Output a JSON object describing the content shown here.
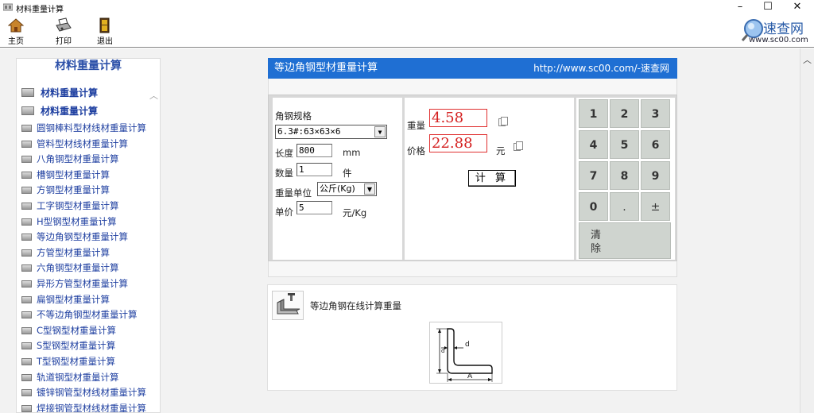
{
  "window": {
    "title": "材料重量计算",
    "controls": {
      "minimize": "–",
      "maximize": "☐",
      "close": "✕"
    }
  },
  "toolbar": {
    "home_label": "主页",
    "print_label": "打印",
    "exit_label": "退出"
  },
  "logo": {
    "brand": "速查网",
    "url": "www.sc00.com"
  },
  "sidebar": {
    "heading": "材料重量计算",
    "items": [
      {
        "label": "材料重量计算",
        "big": true
      },
      {
        "label": "材料重量计算",
        "big": true
      },
      {
        "label": "圆钢棒料型材线材重量计算"
      },
      {
        "label": "管料型材线材重量计算"
      },
      {
        "label": "八角钢型材重量计算"
      },
      {
        "label": "槽钢型材重量计算"
      },
      {
        "label": "方钢型材重量计算"
      },
      {
        "label": "工字钢型材重量计算"
      },
      {
        "label": "H型钢型材重量计算"
      },
      {
        "label": "等边角钢型材重量计算"
      },
      {
        "label": "方管型材重量计算"
      },
      {
        "label": "六角钢型材重量计算"
      },
      {
        "label": "异形方管型材重量计算"
      },
      {
        "label": "扁钢型材重量计算"
      },
      {
        "label": "不等边角钢型材重量计算"
      },
      {
        "label": "C型钢型材重量计算"
      },
      {
        "label": "S型钢型材重量计算"
      },
      {
        "label": "T型钢型材重量计算"
      },
      {
        "label": "轨道钢型材重量计算"
      },
      {
        "label": "镀锌钢管型材线材重量计算"
      },
      {
        "label": "焊接钢管型材线材重量计算"
      }
    ]
  },
  "calculator": {
    "header_title": "等边角钢型材重量计算",
    "header_url": "http://www.sc00.com/-速查网",
    "spec_label": "角钢规格",
    "spec_value": "6.3#:63×63×6",
    "length_label": "长度",
    "length_value": "800",
    "length_unit": "mm",
    "qty_label": "数量",
    "qty_value": "1",
    "qty_unit": "件",
    "weight_unit_label": "重量单位",
    "weight_unit_value": "公斤(Kg)",
    "price_label": "单价",
    "price_value": "5",
    "price_unit": "元/Kg",
    "result_weight_label": "重量",
    "result_weight_value": "4.58",
    "result_price_label": "价格",
    "result_price_value": "22.88",
    "result_price_unit": "元",
    "calc_button": "计 算",
    "keys": [
      "1",
      "2",
      "3",
      "4",
      "5",
      "6",
      "7",
      "8",
      "9",
      "0",
      ".",
      "±"
    ],
    "clear_key_line1": "清",
    "clear_key_line2": "除"
  },
  "description": {
    "title": "等边角钢在线计算重量",
    "figure_labels": {
      "d": "d",
      "a": "A"
    }
  }
}
